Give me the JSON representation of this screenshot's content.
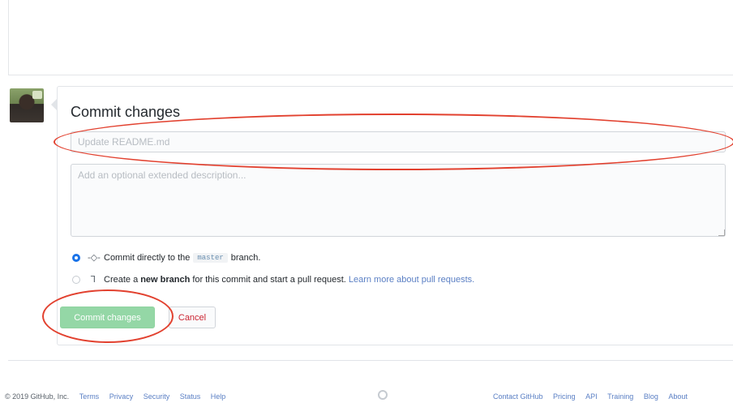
{
  "commit": {
    "title": "Commit changes",
    "summary_placeholder": "Update README.md",
    "summary_value": "",
    "description_placeholder": "Add an optional extended description...",
    "options": [
      {
        "checked": true,
        "icon": "git-commit-icon",
        "text_before": "Commit directly to the",
        "branch": "master",
        "text_after": "branch."
      },
      {
        "checked": false,
        "icon": "git-pull-request-icon",
        "text_before": "Create a",
        "bold": "new branch",
        "text_after": "for this commit and start a pull request.",
        "link": "Learn more about pull requests."
      }
    ],
    "submit_label": "Commit changes",
    "cancel_label": "Cancel"
  },
  "footer": {
    "copyright": "© 2019 GitHub, Inc.",
    "left_links": [
      "Terms",
      "Privacy",
      "Security",
      "Status",
      "Help"
    ],
    "right_links": [
      "Contact GitHub",
      "Pricing",
      "API",
      "Training",
      "Blog",
      "About"
    ]
  },
  "colors": {
    "annotation": "#e2412f",
    "primary_button": "#94d7a6",
    "link": "#5a7fc4",
    "cancel_text": "#cb2431"
  }
}
